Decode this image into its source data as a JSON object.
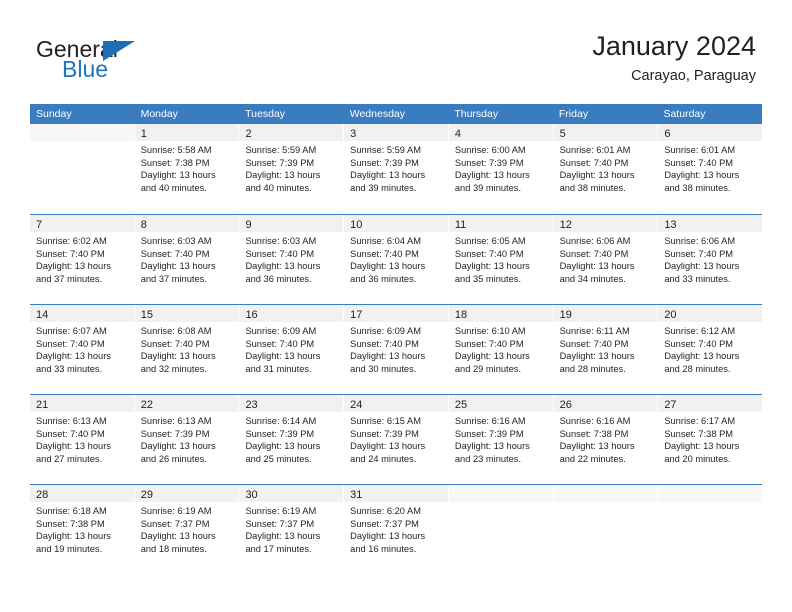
{
  "brand": {
    "word_one": "General",
    "word_two": "Blue",
    "triangle_color": "#1b6fb5"
  },
  "header": {
    "title": "January 2024",
    "subtitle": "Carayao, Paraguay",
    "header_bg": "#3a7cc0",
    "daynum_bg": "#f1f1f1"
  },
  "weekdays": [
    "Sunday",
    "Monday",
    "Tuesday",
    "Wednesday",
    "Thursday",
    "Friday",
    "Saturday"
  ],
  "weeks": [
    [
      {
        "day": "",
        "sunrise": "",
        "sunset": "",
        "daylight_a": "",
        "daylight_b": ""
      },
      {
        "day": "1",
        "sunrise": "Sunrise: 5:58 AM",
        "sunset": "Sunset: 7:38 PM",
        "daylight_a": "Daylight: 13 hours",
        "daylight_b": "and 40 minutes."
      },
      {
        "day": "2",
        "sunrise": "Sunrise: 5:59 AM",
        "sunset": "Sunset: 7:39 PM",
        "daylight_a": "Daylight: 13 hours",
        "daylight_b": "and 40 minutes."
      },
      {
        "day": "3",
        "sunrise": "Sunrise: 5:59 AM",
        "sunset": "Sunset: 7:39 PM",
        "daylight_a": "Daylight: 13 hours",
        "daylight_b": "and 39 minutes."
      },
      {
        "day": "4",
        "sunrise": "Sunrise: 6:00 AM",
        "sunset": "Sunset: 7:39 PM",
        "daylight_a": "Daylight: 13 hours",
        "daylight_b": "and 39 minutes."
      },
      {
        "day": "5",
        "sunrise": "Sunrise: 6:01 AM",
        "sunset": "Sunset: 7:40 PM",
        "daylight_a": "Daylight: 13 hours",
        "daylight_b": "and 38 minutes."
      },
      {
        "day": "6",
        "sunrise": "Sunrise: 6:01 AM",
        "sunset": "Sunset: 7:40 PM",
        "daylight_a": "Daylight: 13 hours",
        "daylight_b": "and 38 minutes."
      }
    ],
    [
      {
        "day": "7",
        "sunrise": "Sunrise: 6:02 AM",
        "sunset": "Sunset: 7:40 PM",
        "daylight_a": "Daylight: 13 hours",
        "daylight_b": "and 37 minutes."
      },
      {
        "day": "8",
        "sunrise": "Sunrise: 6:03 AM",
        "sunset": "Sunset: 7:40 PM",
        "daylight_a": "Daylight: 13 hours",
        "daylight_b": "and 37 minutes."
      },
      {
        "day": "9",
        "sunrise": "Sunrise: 6:03 AM",
        "sunset": "Sunset: 7:40 PM",
        "daylight_a": "Daylight: 13 hours",
        "daylight_b": "and 36 minutes."
      },
      {
        "day": "10",
        "sunrise": "Sunrise: 6:04 AM",
        "sunset": "Sunset: 7:40 PM",
        "daylight_a": "Daylight: 13 hours",
        "daylight_b": "and 36 minutes."
      },
      {
        "day": "11",
        "sunrise": "Sunrise: 6:05 AM",
        "sunset": "Sunset: 7:40 PM",
        "daylight_a": "Daylight: 13 hours",
        "daylight_b": "and 35 minutes."
      },
      {
        "day": "12",
        "sunrise": "Sunrise: 6:06 AM",
        "sunset": "Sunset: 7:40 PM",
        "daylight_a": "Daylight: 13 hours",
        "daylight_b": "and 34 minutes."
      },
      {
        "day": "13",
        "sunrise": "Sunrise: 6:06 AM",
        "sunset": "Sunset: 7:40 PM",
        "daylight_a": "Daylight: 13 hours",
        "daylight_b": "and 33 minutes."
      }
    ],
    [
      {
        "day": "14",
        "sunrise": "Sunrise: 6:07 AM",
        "sunset": "Sunset: 7:40 PM",
        "daylight_a": "Daylight: 13 hours",
        "daylight_b": "and 33 minutes."
      },
      {
        "day": "15",
        "sunrise": "Sunrise: 6:08 AM",
        "sunset": "Sunset: 7:40 PM",
        "daylight_a": "Daylight: 13 hours",
        "daylight_b": "and 32 minutes."
      },
      {
        "day": "16",
        "sunrise": "Sunrise: 6:09 AM",
        "sunset": "Sunset: 7:40 PM",
        "daylight_a": "Daylight: 13 hours",
        "daylight_b": "and 31 minutes."
      },
      {
        "day": "17",
        "sunrise": "Sunrise: 6:09 AM",
        "sunset": "Sunset: 7:40 PM",
        "daylight_a": "Daylight: 13 hours",
        "daylight_b": "and 30 minutes."
      },
      {
        "day": "18",
        "sunrise": "Sunrise: 6:10 AM",
        "sunset": "Sunset: 7:40 PM",
        "daylight_a": "Daylight: 13 hours",
        "daylight_b": "and 29 minutes."
      },
      {
        "day": "19",
        "sunrise": "Sunrise: 6:11 AM",
        "sunset": "Sunset: 7:40 PM",
        "daylight_a": "Daylight: 13 hours",
        "daylight_b": "and 28 minutes."
      },
      {
        "day": "20",
        "sunrise": "Sunrise: 6:12 AM",
        "sunset": "Sunset: 7:40 PM",
        "daylight_a": "Daylight: 13 hours",
        "daylight_b": "and 28 minutes."
      }
    ],
    [
      {
        "day": "21",
        "sunrise": "Sunrise: 6:13 AM",
        "sunset": "Sunset: 7:40 PM",
        "daylight_a": "Daylight: 13 hours",
        "daylight_b": "and 27 minutes."
      },
      {
        "day": "22",
        "sunrise": "Sunrise: 6:13 AM",
        "sunset": "Sunset: 7:39 PM",
        "daylight_a": "Daylight: 13 hours",
        "daylight_b": "and 26 minutes."
      },
      {
        "day": "23",
        "sunrise": "Sunrise: 6:14 AM",
        "sunset": "Sunset: 7:39 PM",
        "daylight_a": "Daylight: 13 hours",
        "daylight_b": "and 25 minutes."
      },
      {
        "day": "24",
        "sunrise": "Sunrise: 6:15 AM",
        "sunset": "Sunset: 7:39 PM",
        "daylight_a": "Daylight: 13 hours",
        "daylight_b": "and 24 minutes."
      },
      {
        "day": "25",
        "sunrise": "Sunrise: 6:16 AM",
        "sunset": "Sunset: 7:39 PM",
        "daylight_a": "Daylight: 13 hours",
        "daylight_b": "and 23 minutes."
      },
      {
        "day": "26",
        "sunrise": "Sunrise: 6:16 AM",
        "sunset": "Sunset: 7:38 PM",
        "daylight_a": "Daylight: 13 hours",
        "daylight_b": "and 22 minutes."
      },
      {
        "day": "27",
        "sunrise": "Sunrise: 6:17 AM",
        "sunset": "Sunset: 7:38 PM",
        "daylight_a": "Daylight: 13 hours",
        "daylight_b": "and 20 minutes."
      }
    ],
    [
      {
        "day": "28",
        "sunrise": "Sunrise: 6:18 AM",
        "sunset": "Sunset: 7:38 PM",
        "daylight_a": "Daylight: 13 hours",
        "daylight_b": "and 19 minutes."
      },
      {
        "day": "29",
        "sunrise": "Sunrise: 6:19 AM",
        "sunset": "Sunset: 7:37 PM",
        "daylight_a": "Daylight: 13 hours",
        "daylight_b": "and 18 minutes."
      },
      {
        "day": "30",
        "sunrise": "Sunrise: 6:19 AM",
        "sunset": "Sunset: 7:37 PM",
        "daylight_a": "Daylight: 13 hours",
        "daylight_b": "and 17 minutes."
      },
      {
        "day": "31",
        "sunrise": "Sunrise: 6:20 AM",
        "sunset": "Sunset: 7:37 PM",
        "daylight_a": "Daylight: 13 hours",
        "daylight_b": "and 16 minutes."
      },
      {
        "day": "",
        "sunrise": "",
        "sunset": "",
        "daylight_a": "",
        "daylight_b": ""
      },
      {
        "day": "",
        "sunrise": "",
        "sunset": "",
        "daylight_a": "",
        "daylight_b": ""
      },
      {
        "day": "",
        "sunrise": "",
        "sunset": "",
        "daylight_a": "",
        "daylight_b": ""
      }
    ]
  ]
}
